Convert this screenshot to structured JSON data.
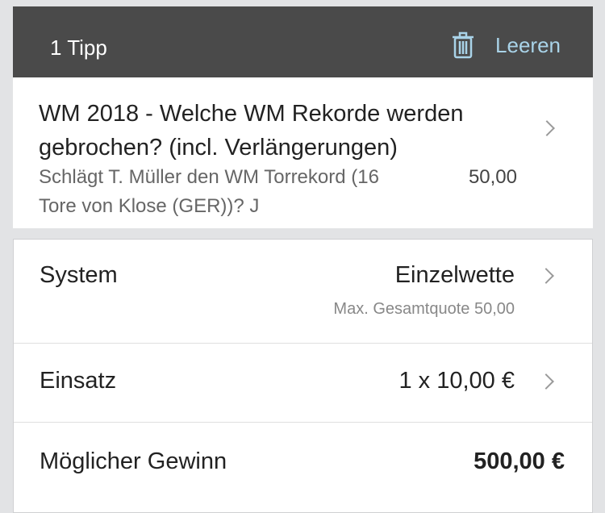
{
  "header": {
    "count_label": "1 Tipp",
    "clear_label": "Leeren",
    "accent_color": "#a9d3e8"
  },
  "bet": {
    "event": "WM 2018 - Welche WM Rekorde werden gebrochen? (incl. Verlängerungen)",
    "selection": "Schlägt T. Müller den WM Torrekord (16 Tore von Klose (GER))? J",
    "odds": "50,00"
  },
  "slip": {
    "system_label": "System",
    "system_value": "Einzelwette",
    "max_odds": "Max. Gesamtquote 50,00",
    "stake_label": "Einsatz",
    "stake_value": "1 x 10,00 €",
    "win_label": "Möglicher Gewinn",
    "win_value": "500,00 €"
  }
}
